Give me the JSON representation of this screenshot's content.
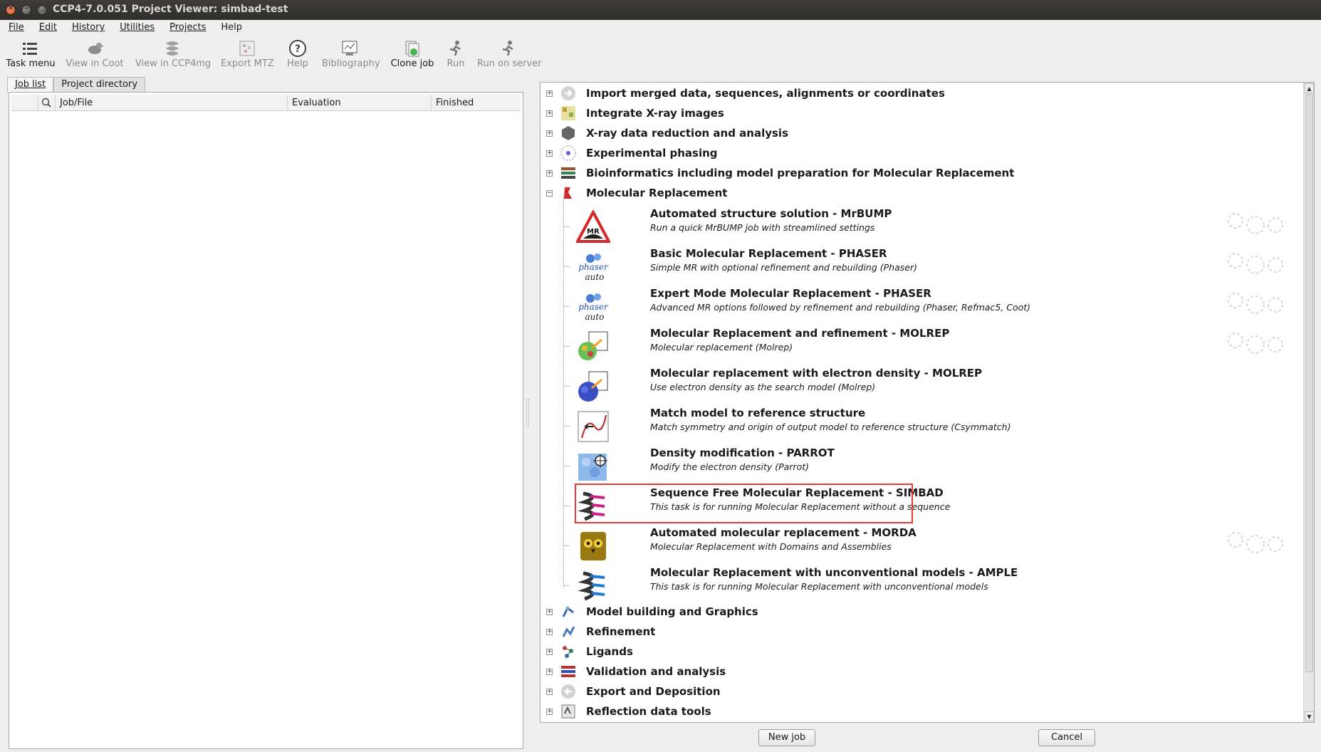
{
  "window": {
    "title": "CCP4-7.0.051 Project Viewer: simbad-test"
  },
  "menu": [
    "File",
    "Edit",
    "History",
    "Utilities",
    "Projects",
    "Help"
  ],
  "toolbar": {
    "task_menu": "Task menu",
    "view_coot": "View in Coot",
    "view_ccp4mg": "View in CCP4mg",
    "export_mtz": "Export MTZ",
    "help": "Help",
    "bibliography": "Bibliography",
    "clone_job": "Clone job",
    "run": "Run",
    "run_server": "Run on server"
  },
  "tabs": {
    "job_list": "Job list",
    "project_directory": "Project directory"
  },
  "job_table": {
    "col_jobfile": "Job/File",
    "col_evaluation": "Evaluation",
    "col_finished": "Finished"
  },
  "categories_top": [
    "Import merged data, sequences, alignments or coordinates",
    "Integrate X-ray images",
    "X-ray data reduction and analysis",
    "Experimental phasing",
    "Bioinformatics including model preparation for Molecular Replacement",
    "Molecular Replacement"
  ],
  "tasks": [
    {
      "title": "Automated structure solution - MrBUMP",
      "desc": "Run a quick MrBUMP job with streamlined settings"
    },
    {
      "title": "Basic Molecular Replacement - PHASER",
      "desc": "Simple MR with optional refinement and rebuilding (Phaser)"
    },
    {
      "title": "Expert Mode Molecular Replacement - PHASER",
      "desc": "Advanced MR options followed by refinement and rebuilding (Phaser, Refmac5, Coot)"
    },
    {
      "title": "Molecular Replacement and refinement - MOLREP",
      "desc": "Molecular replacement (Molrep)"
    },
    {
      "title": "Molecular replacement with electron density - MOLREP",
      "desc": "Use electron density as the search model (Molrep)"
    },
    {
      "title": "Match model to reference structure",
      "desc": "Match symmetry and origin of output model to reference structure (Csymmatch)"
    },
    {
      "title": "Density modification - PARROT",
      "desc": "Modify the electron density (Parrot)"
    },
    {
      "title": "Sequence Free Molecular Replacement - SIMBAD",
      "desc": "This task is for running Molecular Replacement without a sequence"
    },
    {
      "title": "Automated molecular replacement - MORDA",
      "desc": "Molecular Replacement with Domains and Assemblies"
    },
    {
      "title": "Molecular Replacement with unconventional models - AMPLE",
      "desc": "This task is for running Molecular Replacement with unconventional models"
    }
  ],
  "categories_bottom": [
    "Model building and Graphics",
    "Refinement",
    "Ligands",
    "Validation and analysis",
    "Export and Deposition",
    "Reflection data tools"
  ],
  "icons": {
    "mrbump_badge": "MR",
    "phaser_top": "phaser",
    "phaser_bottom": "auto"
  },
  "buttons": {
    "new_job": "New job",
    "cancel": "Cancel"
  },
  "colors": {
    "highlight": "#e53b3b",
    "titlebar": "#3c3b37"
  }
}
